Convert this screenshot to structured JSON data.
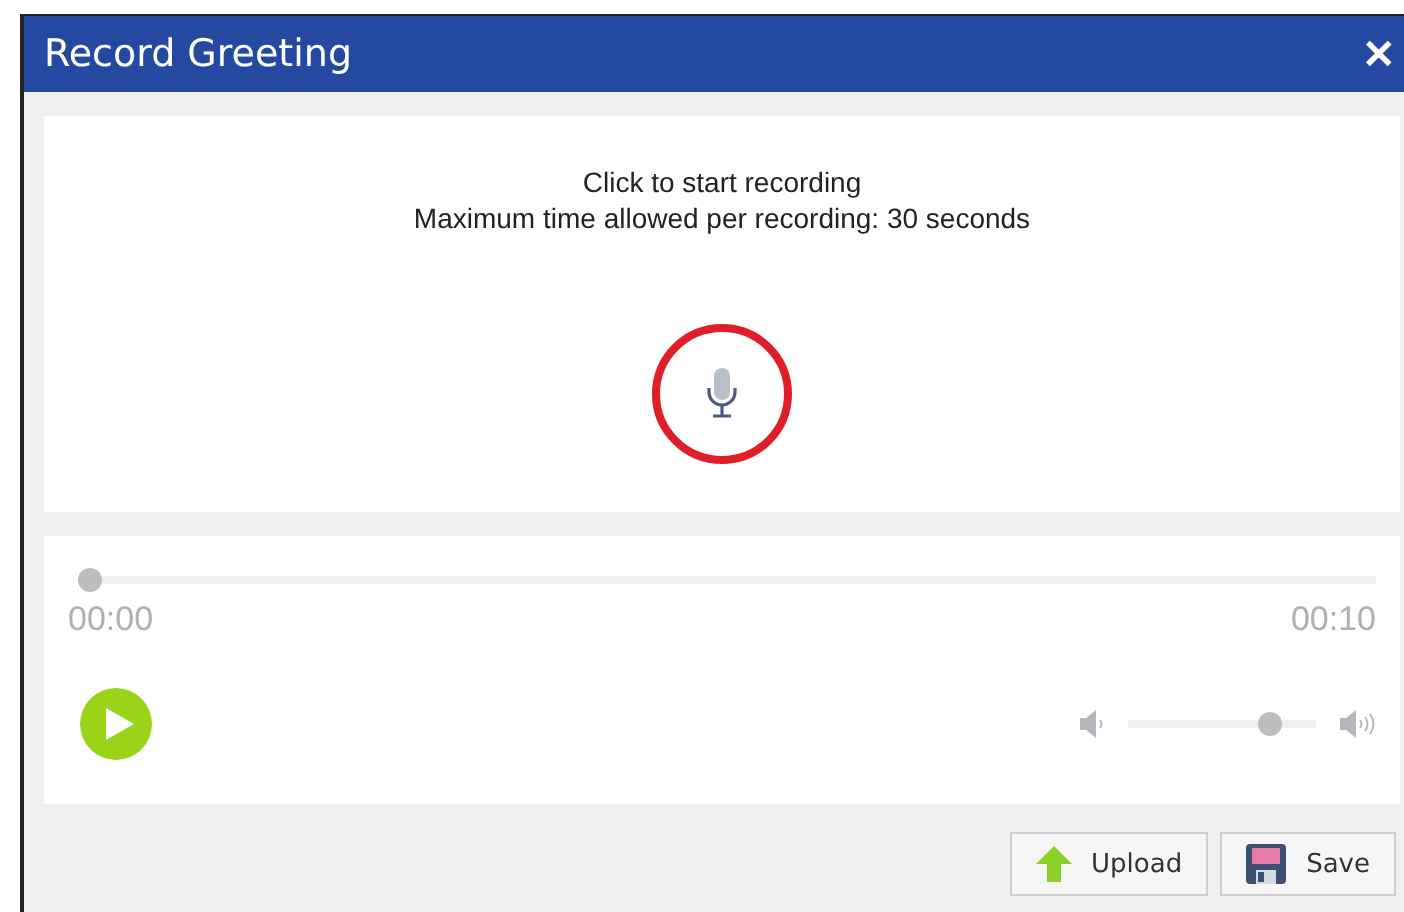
{
  "window": {
    "title": "Record Greeting",
    "close": "✕"
  },
  "recorder": {
    "lines": [
      "Click to start recording",
      "Maximum time allowed per recording: 30 seconds"
    ]
  },
  "player": {
    "progress": {
      "level": 0
    },
    "elapsed": "00:00",
    "duration": "00:10",
    "volume": {
      "level": 0.79
    }
  },
  "buttons": [
    {
      "label": "Upload",
      "kind": "upload"
    },
    {
      "label": "Save",
      "kind": "save"
    }
  ]
}
